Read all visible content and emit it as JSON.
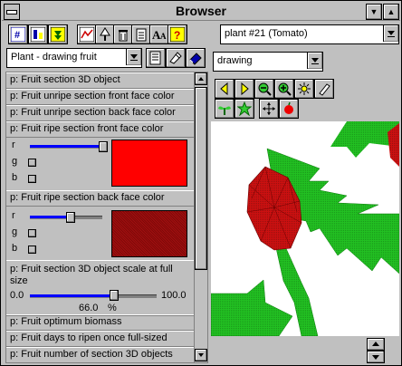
{
  "window": {
    "title": "Browser"
  },
  "toolbar": {
    "plant_selector": "plant #21 (Tomato)",
    "icons": [
      "hash-icon",
      "chart-icon",
      "down-arrow-box-icon",
      "graph-icon",
      "tree-icon",
      "trash-icon",
      "notepad-icon",
      "font-size-icon",
      "help-icon"
    ]
  },
  "left": {
    "section_selector": "Plant - drawing fruit",
    "params": {
      "p1": "p: Fruit section 3D object",
      "p2": "p: Fruit unripe section front face color",
      "p3": "p: Fruit unripe section back face color",
      "p4": "p: Fruit ripe section front face color",
      "p5": "p: Fruit ripe section back face color",
      "p6": "p: Fruit section 3D object scale at full size",
      "p7": "p: Fruit optimum biomass",
      "p8": "p: Fruit days to ripen once full-sized",
      "p9": "p: Fruit number of section 3D objects"
    },
    "color_front": {
      "r": "r",
      "g": "g",
      "b": "b",
      "r_val": 1.0,
      "g_val": 0.0,
      "b_val": 0.0,
      "swatch": "#ff0000"
    },
    "color_back": {
      "r": "r",
      "g": "g",
      "b": "b",
      "r_val": 0.55,
      "g_val": 0.0,
      "b_val": 0.0,
      "swatch": "#a01010"
    },
    "scale": {
      "min": "0.0",
      "max": "100.0",
      "value": "66.0",
      "unit": "%",
      "fraction": 0.66
    }
  },
  "right": {
    "view_selector": "drawing",
    "colors": {
      "leaf": "#1fbf1f",
      "fruit": "#cc0000",
      "stem": "#1fbf1f"
    }
  }
}
